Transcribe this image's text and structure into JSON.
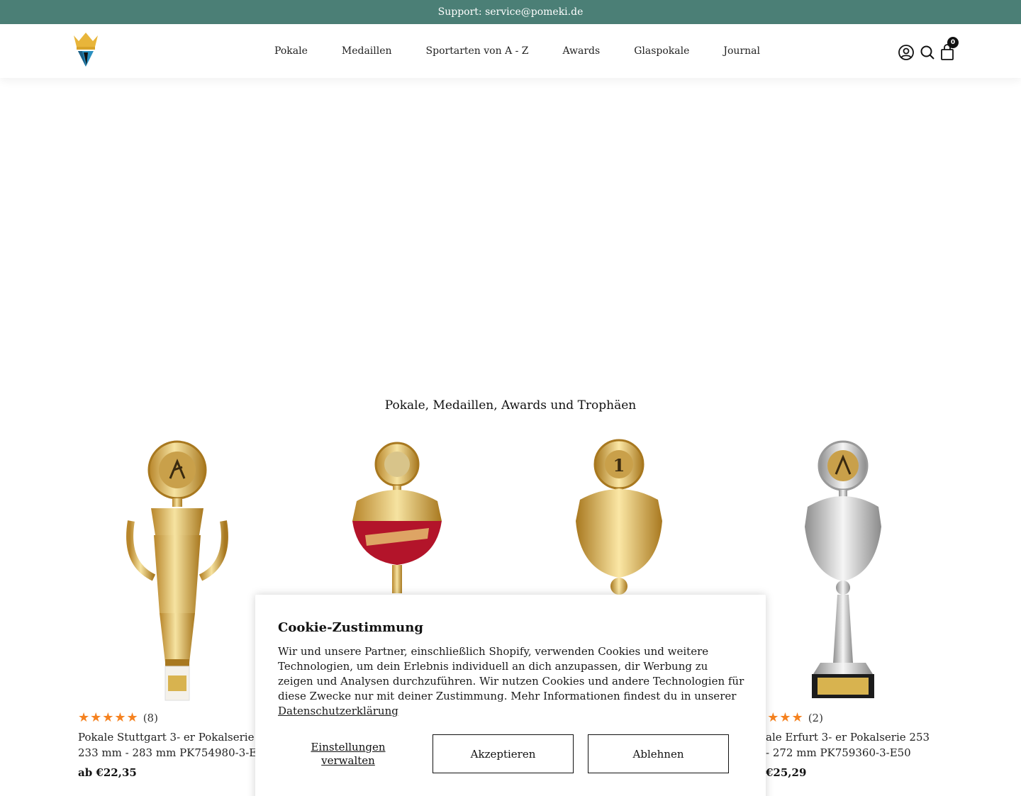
{
  "topbar": {
    "support_text": "Support: service@pomeki.de"
  },
  "nav": {
    "items": [
      "Pokale",
      "Medaillen",
      "Sportarten von A - Z",
      "Awards",
      "Glaspokale",
      "Journal"
    ]
  },
  "header": {
    "cart_count": "0"
  },
  "section": {
    "title": "Pokale, Medaillen, Awards und Trophäen"
  },
  "products": [
    {
      "stars": "★★★★★",
      "reviews": "(8)",
      "title_line1": "Pokale Stuttgart 3- er Pokalserie",
      "title_line2": "233 mm - 283 mm PK754980-3-E",
      "price": "ab €22,35"
    },
    {
      "stars": "★★★★★",
      "reviews": "(2)",
      "title_line1": "ale Erfurt 3- er Pokalserie 253",
      "title_line2": "- 272 mm PK759360-3-E50",
      "price": "€25,29"
    }
  ],
  "cookie": {
    "title": "Cookie-Zustimmung",
    "body": "Wir und unsere Partner, einschließlich Shopify, verwenden Cookies und weitere Technologien, um dein Erlebnis individuell an dich anzupassen, dir Werbung zu zeigen und Analysen durchzuführen. Wir nutzen Cookies und andere Technologien für diese Zwecke nur mit deiner Zustimmung. Mehr Informationen findest du in unserer",
    "link": "Datenschutzerklärung",
    "settings_line1": "Einstellungen",
    "settings_line2": "verwalten",
    "accept": "Akzeptieren",
    "decline": "Ablehnen"
  },
  "colors": {
    "topbar": "#4b7f76",
    "stars": "#f58220",
    "gold": "#d9b654",
    "silver": "#c9c9c9",
    "red": "#b3142a"
  }
}
